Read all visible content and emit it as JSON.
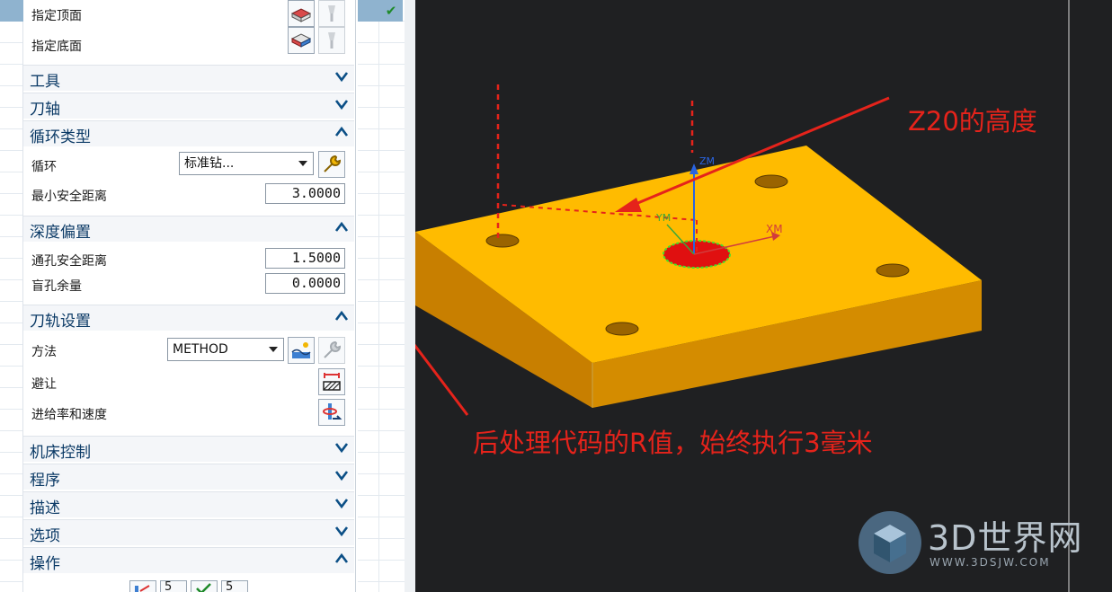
{
  "dialog": {
    "rows": {
      "top_face_label": "指定顶面",
      "bottom_face_label": "指定底面"
    },
    "sections": {
      "tool": "工具",
      "tool_axis": "刀轴",
      "cycle_type": "循环类型",
      "depth_offset": "深度偏置",
      "path_settings": "刀轨设置",
      "machine_control": "机床控制",
      "program": "程序",
      "description": "描述",
      "options": "选项",
      "actions": "操作"
    },
    "cycle": {
      "label": "循环",
      "value": "标准钻...",
      "min_clearance_label": "最小安全距离",
      "min_clearance_value": "3.0000"
    },
    "depth": {
      "through_label": "通孔安全距离",
      "through_value": "1.5000",
      "blind_label": "盲孔余量",
      "blind_value": "0.0000"
    },
    "path": {
      "method_label": "方法",
      "method_value": "METHOD",
      "avoid_label": "避让",
      "feeds_label": "进给率和速度"
    },
    "action_buttons": [
      "5",
      "5"
    ]
  },
  "viewport": {
    "axes": {
      "zm": "ZM",
      "ym": "YM",
      "xm": "XM"
    },
    "annotations": {
      "z20": "Z20的高度",
      "r_value": "后处理代码的R值，始终执行3毫米"
    },
    "colors": {
      "part": "#ffbb00",
      "annotation": "#e5231b",
      "background": "#1f2022"
    },
    "watermark": {
      "title": "3D世界网",
      "url": "WWW.3DSJW.COM"
    }
  }
}
